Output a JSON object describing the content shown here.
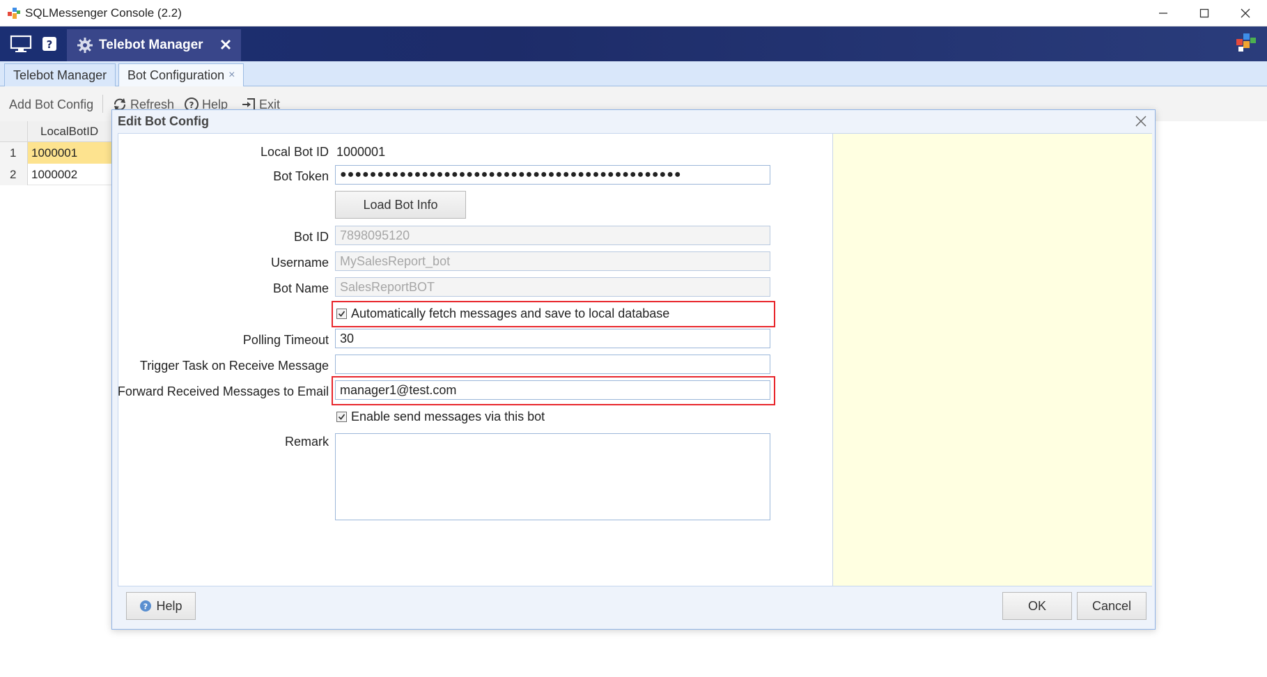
{
  "window": {
    "title": "SQLMessenger Console (2.2)"
  },
  "header": {
    "active_tab_label": "Telebot Manager"
  },
  "tabs": [
    {
      "label": "Telebot Manager"
    },
    {
      "label": "Bot Configuration",
      "close": "×"
    }
  ],
  "toolbar": {
    "add": "Add Bot Config",
    "refresh": "Refresh",
    "help": "Help",
    "exit": "Exit"
  },
  "grid": {
    "column": "LocalBotID",
    "rows": [
      {
        "num": "1",
        "value": "1000001"
      },
      {
        "num": "2",
        "value": "1000002"
      }
    ]
  },
  "dialog": {
    "title": "Edit Bot Config",
    "fields": {
      "local_bot_id_label": "Local Bot ID",
      "local_bot_id_value": "1000001",
      "bot_token_label": "Bot Token",
      "bot_token_value": "●●●●●●●●●●●●●●●●●●●●●●●●●●●●●●●●●●●●●●●●●●●●●●",
      "load_bot_info": "Load Bot Info",
      "bot_id_label": "Bot ID",
      "bot_id_value": "7898095120",
      "username_label": "Username",
      "username_value": "MySalesReport_bot",
      "bot_name_label": "Bot Name",
      "bot_name_value": "SalesReportBOT",
      "auto_fetch_label": "Automatically fetch messages and save to local database",
      "polling_timeout_label": "Polling Timeout",
      "polling_timeout_value": "30",
      "trigger_task_label": "Trigger Task on Receive Message",
      "trigger_task_value": "",
      "forward_email_label": "Forward Received Messages to Email",
      "forward_email_value": "manager1@test.com",
      "enable_send_label": "Enable send messages via this bot",
      "remark_label": "Remark",
      "remark_value": ""
    },
    "footer": {
      "help": "Help",
      "ok": "OK",
      "cancel": "Cancel"
    }
  },
  "colors": {
    "header_bg": "#1d2c69",
    "tab_bg": "#d9e7fa",
    "selected_row": "#fde38f",
    "side_panel": "#ffffe1",
    "highlight": "#e8252b"
  }
}
